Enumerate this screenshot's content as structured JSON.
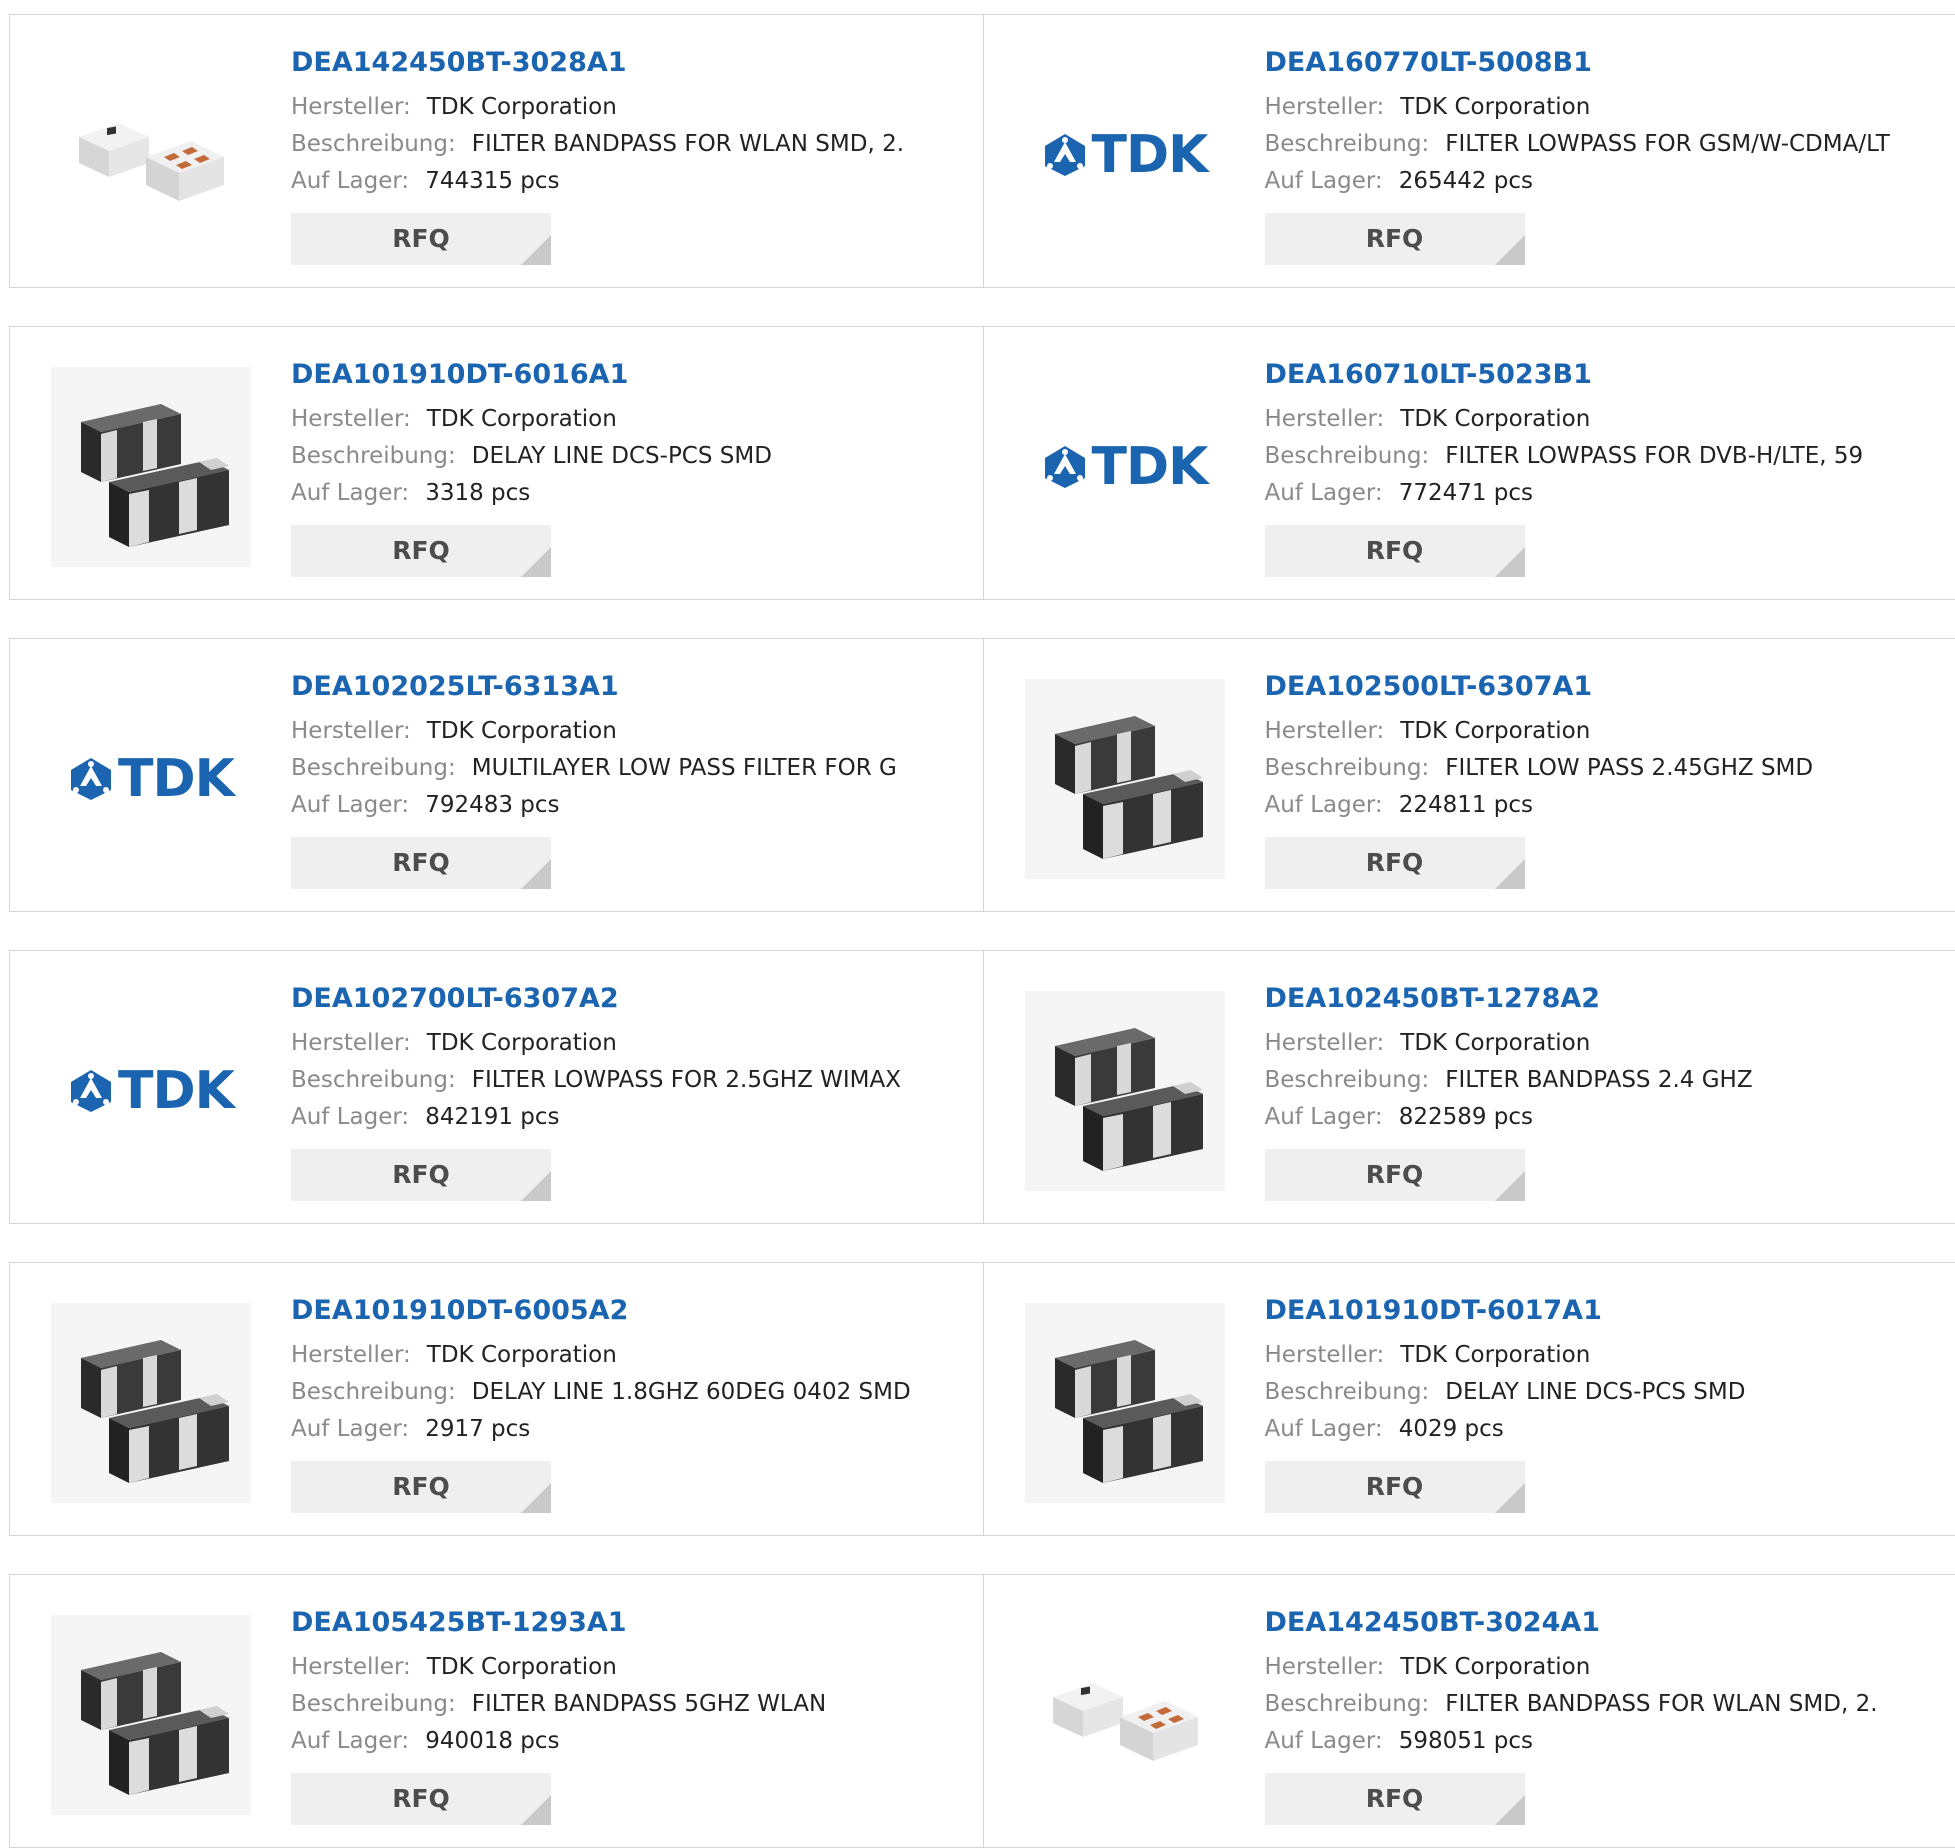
{
  "colors": {
    "accent": "#1a64b0",
    "label": "#8a8a8a",
    "button_bg": "#efefef"
  },
  "labels": {
    "manufacturer": "Hersteller:",
    "description": "Beschreibung:",
    "stock": "Auf Lager:",
    "rfq": "RFQ"
  },
  "logo_text": "TDK",
  "products": [
    {
      "part": "DEA142450BT-3028A1",
      "manufacturer": "TDK Corporation",
      "description": "FILTER BANDPASS FOR WLAN SMD, 2.",
      "stock": "744315 pcs",
      "image": "smd-white-chip"
    },
    {
      "part": "DEA160770LT-5008B1",
      "manufacturer": "TDK Corporation",
      "description": "FILTER LOWPASS FOR GSM/W-CDMA/LT",
      "stock": "265442 pcs",
      "image": "tdk-logo"
    },
    {
      "part": "DEA101910DT-6016A1",
      "manufacturer": "TDK Corporation",
      "description": "DELAY LINE DCS-PCS SMD",
      "stock": "3318 pcs",
      "image": "smd-black-chip"
    },
    {
      "part": "DEA160710LT-5023B1",
      "manufacturer": "TDK Corporation",
      "description": "FILTER LOWPASS FOR DVB-H/LTE, 59",
      "stock": "772471 pcs",
      "image": "tdk-logo"
    },
    {
      "part": "DEA102025LT-6313A1",
      "manufacturer": "TDK Corporation",
      "description": "MULTILAYER LOW PASS FILTER FOR G",
      "stock": "792483 pcs",
      "image": "tdk-logo"
    },
    {
      "part": "DEA102500LT-6307A1",
      "manufacturer": "TDK Corporation",
      "description": "FILTER LOW PASS 2.45GHZ SMD",
      "stock": "224811 pcs",
      "image": "smd-black-chip"
    },
    {
      "part": "DEA102700LT-6307A2",
      "manufacturer": "TDK Corporation",
      "description": "FILTER LOWPASS FOR 2.5GHZ WIMAX",
      "stock": "842191 pcs",
      "image": "tdk-logo"
    },
    {
      "part": "DEA102450BT-1278A2",
      "manufacturer": "TDK Corporation",
      "description": "FILTER BANDPASS 2.4 GHZ",
      "stock": "822589 pcs",
      "image": "smd-black-chip"
    },
    {
      "part": "DEA101910DT-6005A2",
      "manufacturer": "TDK Corporation",
      "description": "DELAY LINE 1.8GHZ 60DEG 0402 SMD",
      "stock": "2917 pcs",
      "image": "smd-black-chip"
    },
    {
      "part": "DEA101910DT-6017A1",
      "manufacturer": "TDK Corporation",
      "description": "DELAY LINE DCS-PCS SMD",
      "stock": "4029 pcs",
      "image": "smd-black-chip"
    },
    {
      "part": "DEA105425BT-1293A1",
      "manufacturer": "TDK Corporation",
      "description": "FILTER BANDPASS 5GHZ WLAN",
      "stock": "940018 pcs",
      "image": "smd-black-chip"
    },
    {
      "part": "DEA142450BT-3024A1",
      "manufacturer": "TDK Corporation",
      "description": "FILTER BANDPASS FOR WLAN SMD, 2.",
      "stock": "598051 pcs",
      "image": "smd-white-chip"
    }
  ]
}
